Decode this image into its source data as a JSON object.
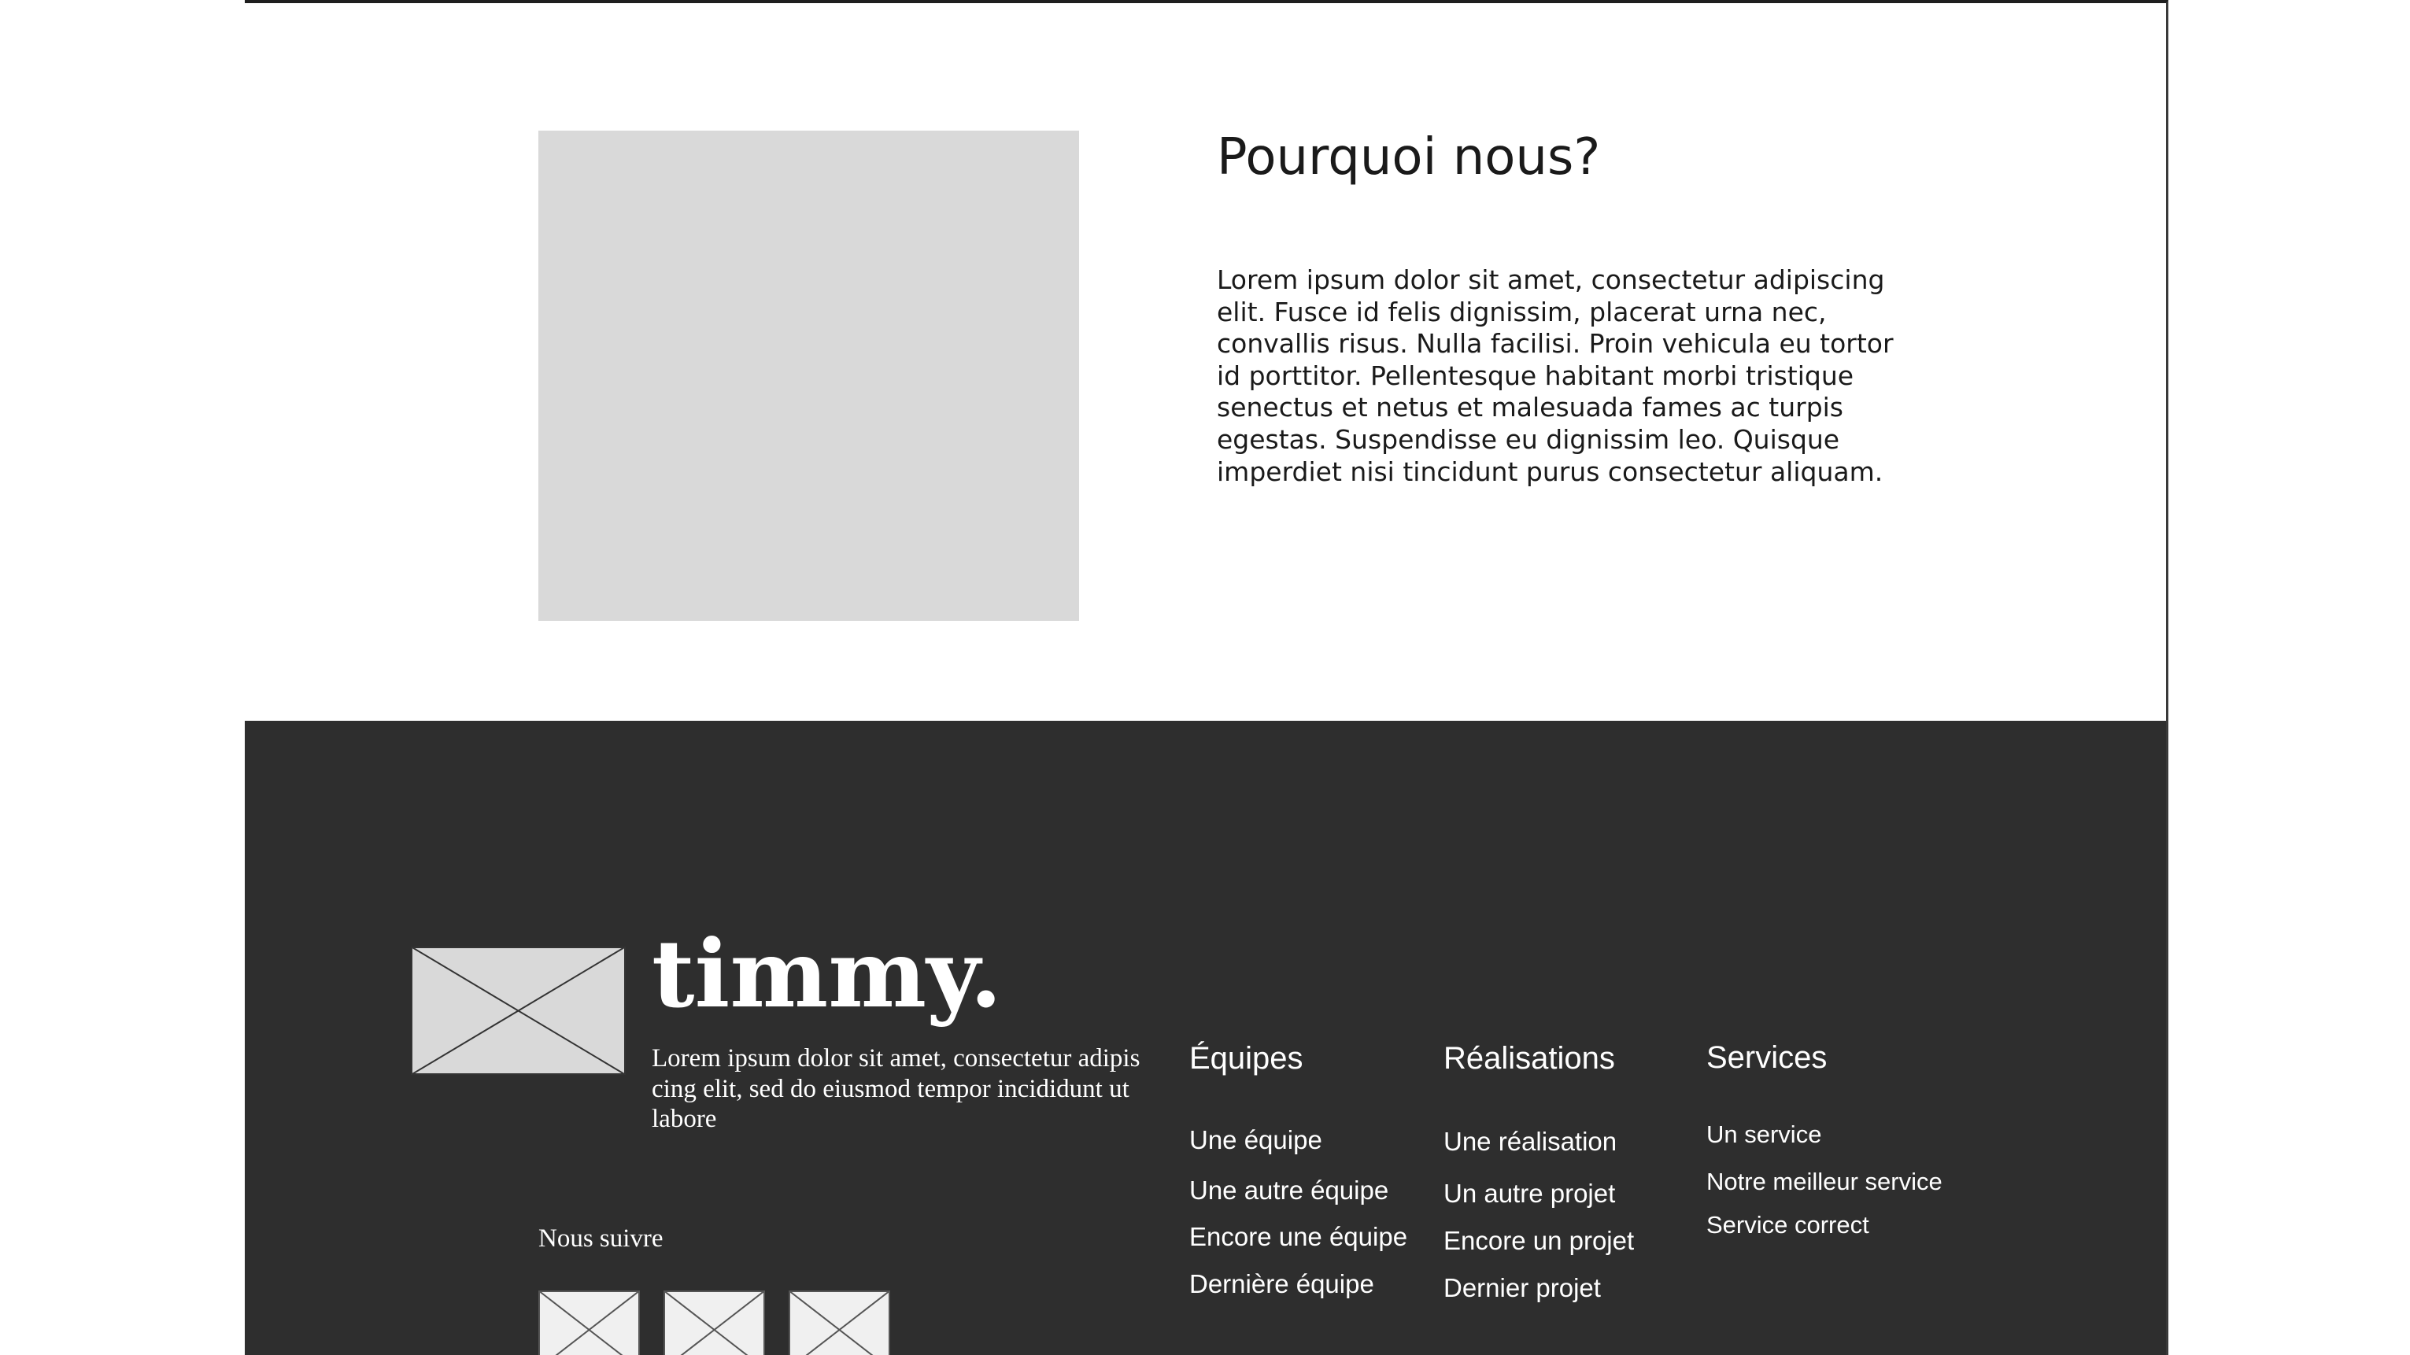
{
  "about": {
    "title": "Pourquoi nous?",
    "text": "Lorem ipsum dolor sit amet, consectetur adipiscing elit. Fusce id felis dignissim, placerat urna nec, convallis risus. Nulla facilisi. Proin vehicula eu tortor id porttitor. Pellentesque habitant morbi tristique senectus et netus et malesuada fames ac turpis egestas. Suspendisse eu dignissim leo. Quisque imperdiet nisi tincidunt purus consectetur aliquam."
  },
  "footer": {
    "brand": {
      "name": "timmy.",
      "tagline": "Lorem ipsum dolor sit amet, consectetur adipis cing elit, sed do eiusmod tempor incididunt ut labore"
    },
    "follow_label": "Nous suivre",
    "columns": [
      {
        "heading": "Équipes",
        "links": [
          "Une équipe",
          "Une autre équipe",
          "Encore une équipe",
          "Dernière équipe"
        ]
      },
      {
        "heading": "Réalisations",
        "links": [
          "Une réalisation",
          "Un autre projet",
          "Encore un projet",
          "Dernier projet"
        ]
      },
      {
        "heading": "Services",
        "links": [
          "Un service",
          "Notre meilleur service",
          "Service correct"
        ]
      }
    ]
  },
  "colors": {
    "footer_background": "#2e2e2e",
    "placeholder": "#d9d9d9",
    "text_dark": "#1a1a1a",
    "text_light": "#ffffff"
  }
}
